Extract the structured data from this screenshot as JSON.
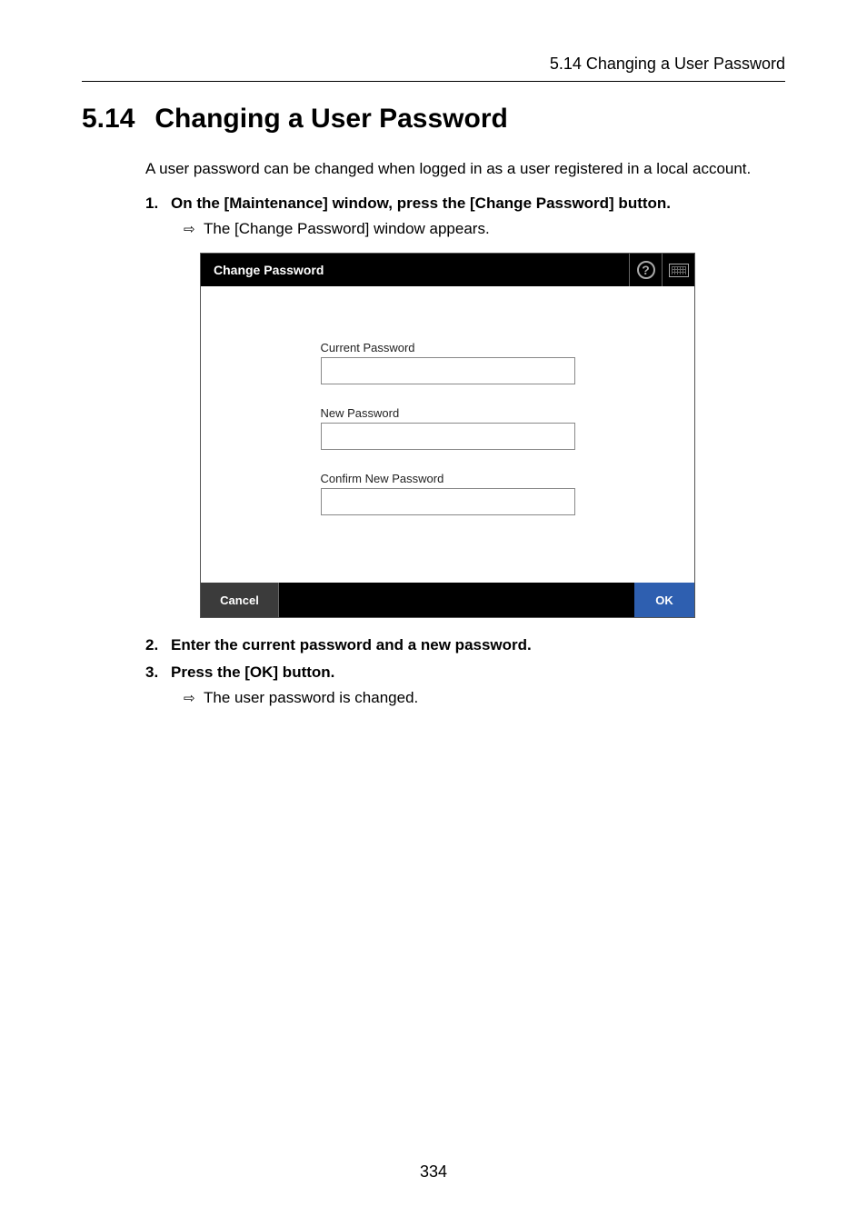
{
  "header": {
    "running_head": "5.14 Changing a User Password"
  },
  "section": {
    "number": "5.14",
    "title": "Changing a User Password"
  },
  "intro": "A user password can be changed when logged in as a user registered in a local account.",
  "steps": {
    "s1": {
      "num": "1.",
      "text": "On the [Maintenance] window, press the [Change Password] button."
    },
    "s1_result": "The [Change Password] window appears.",
    "s2": {
      "num": "2.",
      "text": "Enter the current password and a new password."
    },
    "s3": {
      "num": "3.",
      "text": "Press the [OK] button."
    },
    "s3_result": "The user password is changed."
  },
  "dialog": {
    "title": "Change Password",
    "help_glyph": "?",
    "labels": {
      "current": "Current Password",
      "new": "New Password",
      "confirm": "Confirm New Password"
    },
    "buttons": {
      "cancel": "Cancel",
      "ok": "OK"
    }
  },
  "arrow_glyph": "⇨",
  "page_number": "334"
}
